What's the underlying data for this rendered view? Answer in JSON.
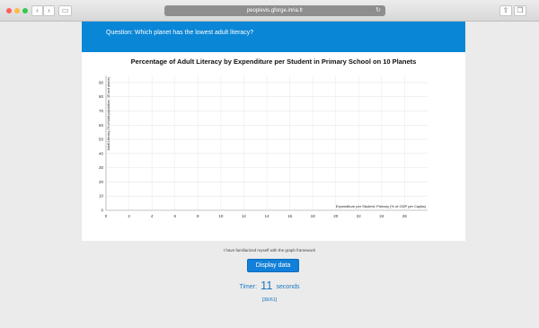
{
  "browser": {
    "url": "peoplevis.gforge.inria.fr",
    "back_icon": "chevron-left-icon",
    "forward_icon": "chevron-right-icon",
    "reload_icon": "reload-icon"
  },
  "question": {
    "text": "Question: Which planet has the lowest adult literacy?"
  },
  "chart_data": {
    "type": "scatter",
    "title": "Percentage of Adult Literacy by Expenditure per Student in Primary School on 10 Planets",
    "xlabel": "Expenditure per Student, Primary (% of GDP per Capita)",
    "ylabel": "Adult Literacy (% of total population, 15 and above)",
    "xlim": [
      0,
      28
    ],
    "ylim": [
      0,
      95
    ],
    "x_ticks": [
      "0",
      "2",
      "4",
      "6",
      "8",
      "10",
      "12",
      "14",
      "16",
      "18",
      "20",
      "22",
      "24",
      "26"
    ],
    "y_ticks": [
      "0",
      "10",
      "20",
      "30",
      "40",
      "50",
      "60",
      "70",
      "80",
      "90"
    ],
    "points": [],
    "grid": true
  },
  "familiarized_text": "I have familiarized myself with the graph framework",
  "display_button_label": "Display data",
  "timer": {
    "prefix": "Timer:",
    "value": "11",
    "suffix": "seconds"
  },
  "progress_text": "[38/61]"
}
